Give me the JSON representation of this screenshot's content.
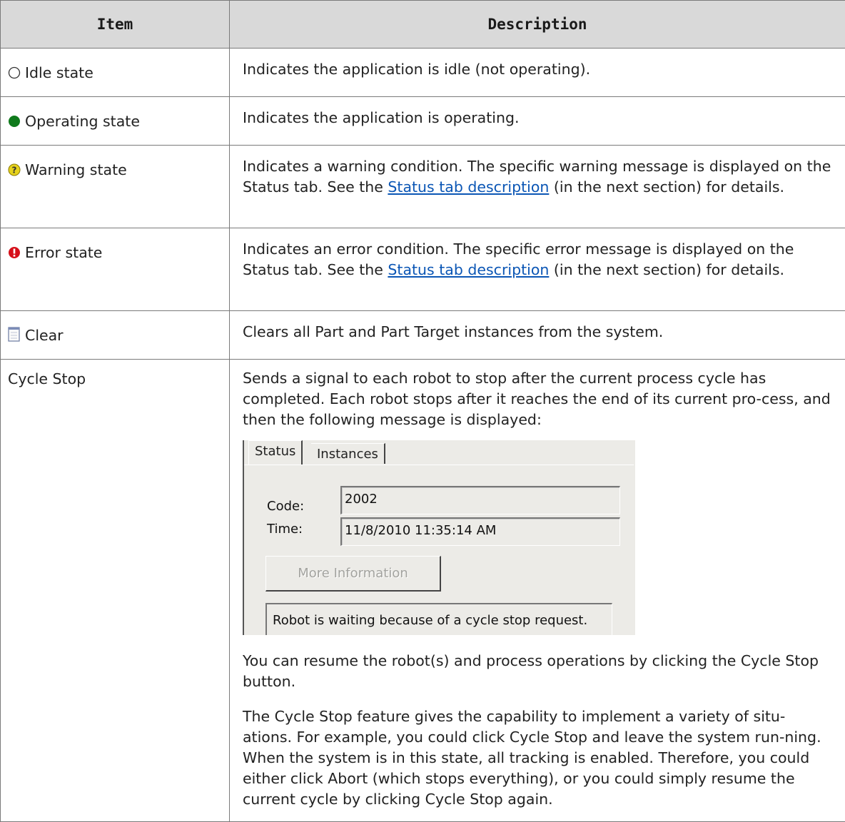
{
  "table": {
    "headers": {
      "item": "Item",
      "description": "Description"
    },
    "rows": [
      {
        "icon": "idle-circle-icon",
        "item": "Idle state",
        "desc": "Indicates the application is idle (not operating)."
      },
      {
        "icon": "green-dot-icon",
        "item": "Operating state",
        "desc": "Indicates the application is operating."
      },
      {
        "icon": "warning-icon",
        "item": "Warning state",
        "desc_a": "Indicates a warning condition. The specific warning message is displayed on the Status tab. See the ",
        "link": "Status tab description",
        "desc_b": " (in the next section) for details."
      },
      {
        "icon": "error-icon",
        "item": "Error state",
        "desc_a": "Indicates an error condition. The specific error message is displayed on the Status tab. See the ",
        "link": "Status tab description",
        "desc_b": " (in the next section) for details."
      },
      {
        "icon": "clear-icon",
        "item": "Clear",
        "desc": "Clears all Part and Part Target instances from the system."
      },
      {
        "item": "Cycle Stop",
        "desc_p1": "Sends a signal to each robot to stop after the current process cycle has completed. Each robot stops after it reaches the end of its current pro-cess, and then the following message is displayed:",
        "desc_p2": "You can resume the robot(s) and process operations by clicking the Cycle Stop button.",
        "desc_p3": "The Cycle Stop feature gives the capability to implement a variety of situ-ations. For example, you could click Cycle Stop and leave the system run-ning. When the system is in this state, all tracking is enabled. Therefore, you could either click Abort (which stops everything), or you could simply resume the current cycle by clicking Cycle Stop again."
      }
    ]
  },
  "screenshot": {
    "tab_status": "Status",
    "tab_instances": "Instances",
    "code_label": "Code:",
    "code_value": "2002",
    "time_label": "Time:",
    "time_value": "11/8/2010 11:35:14 AM",
    "more_info_button": "More Information",
    "message": "Robot is waiting because of a cycle stop request."
  },
  "colors": {
    "header_bg": "#d9d9d9",
    "link": "#0b56b5",
    "operating": "#0f7a1c",
    "warning": "#e6d21c",
    "error": "#d6101a"
  }
}
